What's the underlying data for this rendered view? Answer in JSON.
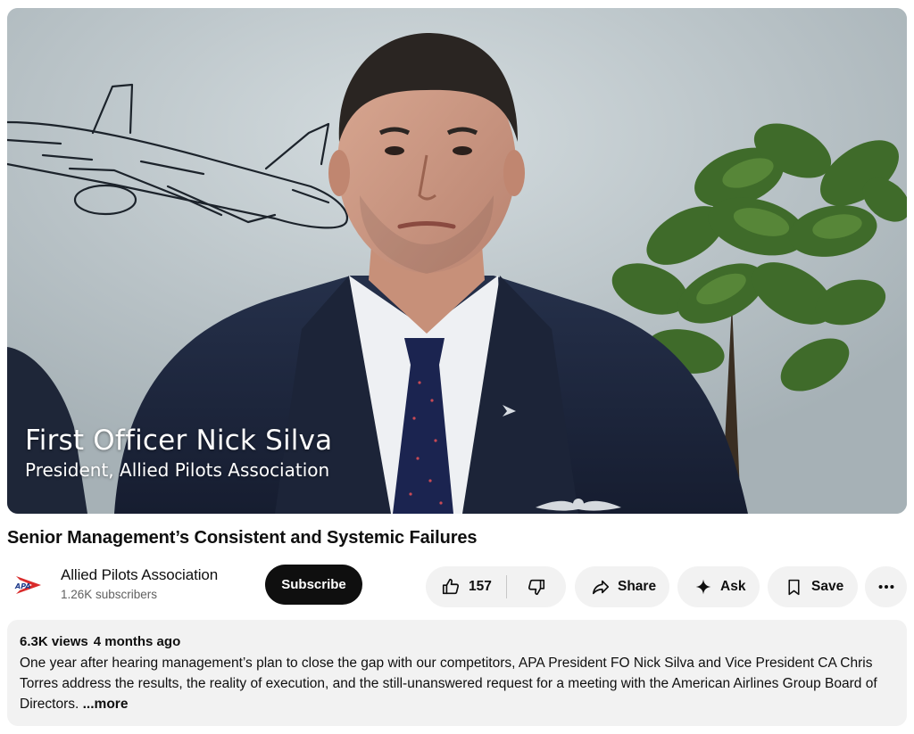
{
  "video": {
    "caption_name": "First Officer Nick Silva",
    "caption_role": "President, Allied Pilots Association",
    "title": "Senior Management’s Consistent and Systemic Failures"
  },
  "channel": {
    "avatar_text": "APA",
    "name": "Allied Pilots Association",
    "subscribers": "1.26K subscribers",
    "subscribe_label": "Subscribe"
  },
  "actions": {
    "like_count": "157",
    "share_label": "Share",
    "ask_label": "Ask",
    "save_label": "Save"
  },
  "description": {
    "views": "6.3K views",
    "age": "4 months ago",
    "text": "One year after hearing management’s plan to close the gap with our competitors, APA President FO Nick Silva and Vice President CA Chris Torres address the results, the reality of execution, and the still-unanswered request for a meeting with the American Airlines Group Board of Directors. ",
    "more_label": "...more"
  },
  "icons": {
    "like": "thumbs-up-icon",
    "dislike": "thumbs-down-icon",
    "share": "share-arrow-icon",
    "ask": "sparkle-icon",
    "save": "bookmark-icon",
    "more": "more-horizontal-icon"
  },
  "colors": {
    "subscribe_bg": "#0f0f0f",
    "pill_bg": "#f2f2f2",
    "apa_red": "#d92b2b",
    "apa_blue": "#1e3a8a"
  }
}
